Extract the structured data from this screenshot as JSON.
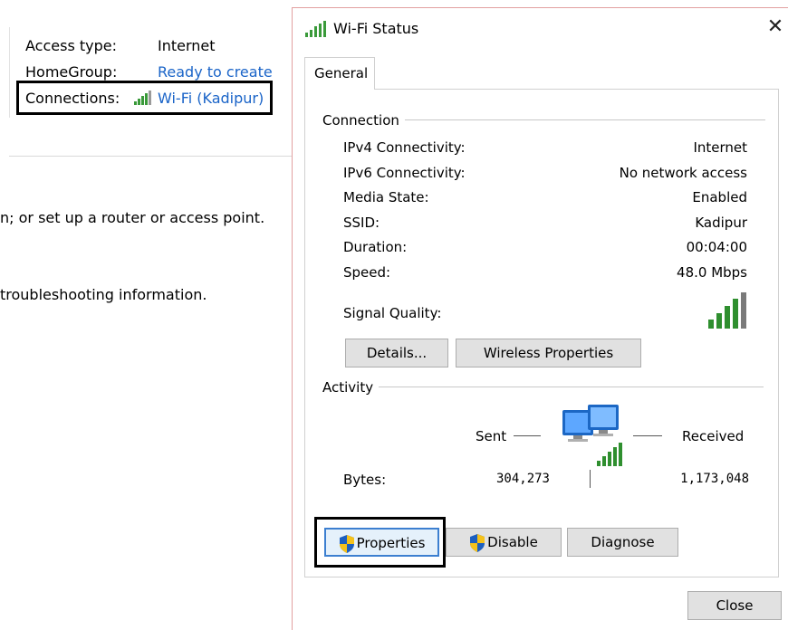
{
  "background": {
    "access_type_label": "Access type:",
    "access_type_value": "Internet",
    "homegroup_label": "HomeGroup:",
    "homegroup_value": "Ready to create",
    "connections_label": "Connections:",
    "connections_value": "Wi-Fi (Kadipur)",
    "text_router": "n; or set up a router or access point.",
    "text_troubleshoot": "troubleshooting information."
  },
  "dialog": {
    "title": "Wi-Fi Status",
    "close_glyph": "✕",
    "tab_general": "General",
    "connection": {
      "group_label": "Connection",
      "rows": [
        {
          "label": "IPv4 Connectivity:",
          "value": "Internet"
        },
        {
          "label": "IPv6 Connectivity:",
          "value": "No network access"
        },
        {
          "label": "Media State:",
          "value": "Enabled"
        },
        {
          "label": "SSID:",
          "value": "Kadipur"
        },
        {
          "label": "Duration:",
          "value": "00:04:00"
        },
        {
          "label": "Speed:",
          "value": "48.0 Mbps"
        }
      ],
      "signal_label": "Signal Quality:",
      "signal_bars": 5,
      "details_button": "Details...",
      "wireless_props_button": "Wireless Properties"
    },
    "activity": {
      "group_label": "Activity",
      "sent_label": "Sent",
      "received_label": "Received",
      "bytes_label": "Bytes:",
      "sent_bytes": "304,273",
      "received_bytes": "1,173,048"
    },
    "buttons": {
      "properties": "Properties",
      "disable": "Disable",
      "diagnose": "Diagnose",
      "close": "Close"
    },
    "colors": {
      "signal_green": "#3a9a3a",
      "link_blue": "#1a64c8",
      "button_face": "#e1e1e1"
    }
  }
}
